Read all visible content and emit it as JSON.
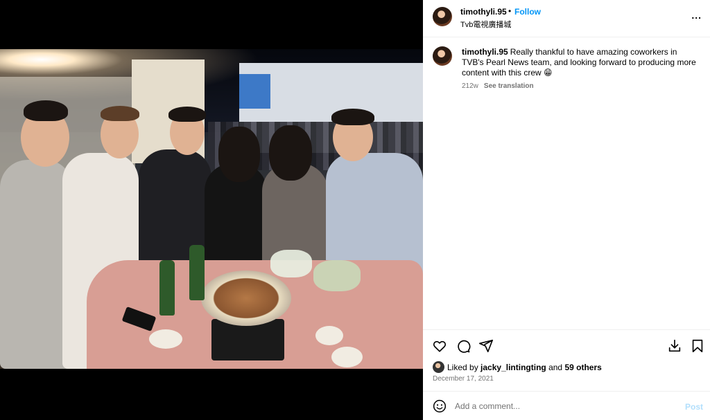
{
  "post": {
    "username": "timothyli.95",
    "dot": "•",
    "follow_label": "Follow",
    "location": "Tvb電視廣播城",
    "more_label": "..."
  },
  "caption": {
    "username": "timothyli.95",
    "text": "Really thankful to have amazing coworkers in TVB's Pearl News team, and looking forward to producing more content with this crew 😁",
    "age": "212w",
    "translate_label": "See translation"
  },
  "actions": {
    "like_icon": "heart-icon",
    "comment_icon": "comment-icon",
    "share_icon": "share-icon",
    "download_icon": "download-icon",
    "save_icon": "bookmark-icon"
  },
  "likes": {
    "prefix": "Liked by",
    "user": "jacky_lintingting",
    "conjunction": "and",
    "others": "59 others"
  },
  "date": "December 17, 2021",
  "comment": {
    "placeholder": "Add a comment...",
    "post_label": "Post"
  },
  "colors": {
    "accent": "#0095f6",
    "post_disabled": "#b2dffc",
    "muted": "#737373"
  }
}
